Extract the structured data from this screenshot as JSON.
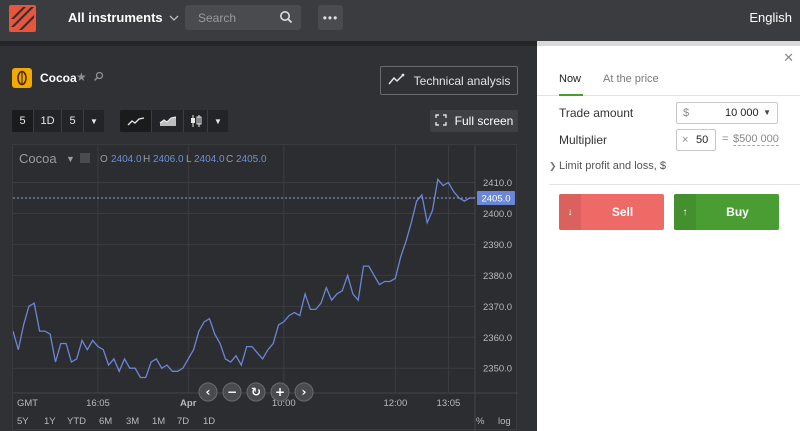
{
  "topbar": {
    "instruments_label": "All instruments",
    "search_placeholder": "Search",
    "more_label": "•••",
    "language": "English"
  },
  "asset": {
    "name": "Cocoa",
    "icon": "cocoa-bean-icon",
    "icon_color": "#f2a900"
  },
  "toolbar": {
    "technical_analysis": "Technical analysis",
    "full_screen": "Full screen",
    "interval_buttons": [
      "5",
      "1D",
      "5"
    ],
    "chart_type_icons": [
      "line-chart-icon",
      "area-chart-icon",
      "candlestick-icon"
    ]
  },
  "chart_header": {
    "asset": "Cocoa",
    "o_label": "O",
    "o_value": "2404.0",
    "h_label": "H",
    "h_value": "2406.0",
    "l_label": "L",
    "l_value": "2404.0",
    "c_label": "C",
    "c_value": "2405.0"
  },
  "chart_data": {
    "type": "line",
    "series": [
      {
        "values": [
          2362,
          2356,
          2364,
          2370,
          2371,
          2362,
          2362,
          2361,
          2352,
          2358,
          2358,
          2352,
          2353,
          2359,
          2356,
          2359,
          2357,
          2356,
          2351,
          2353,
          2349,
          2353,
          2350,
          2350,
          2347,
          2347,
          2352,
          2353,
          2350,
          2351,
          2349,
          2349,
          2350,
          2353,
          2356,
          2362,
          2365,
          2366,
          2361,
          2358,
          2353,
          2352,
          2354,
          2351,
          2357,
          2357,
          2355,
          2353,
          2356,
          2358,
          2364,
          2365,
          2367,
          2368,
          2367,
          2374,
          2369,
          2369,
          2371,
          2376,
          2372,
          2374,
          2375,
          2380,
          2374,
          2372,
          2383,
          2383,
          2380,
          2377,
          2378,
          2378,
          2379,
          2386,
          2391,
          2397,
          2404,
          2406,
          2397,
          2401,
          2411,
          2409,
          2410,
          2407,
          2405,
          2404,
          2405,
          2405
        ]
      }
    ],
    "current_price": "2405.0",
    "current_price_value": 2405,
    "ylim": [
      2342,
      2415
    ],
    "y_ticks": [
      "2410.0",
      "2400.0",
      "2390.0",
      "2380.0",
      "2370.0",
      "2360.0",
      "2350.0"
    ],
    "y_tick_values": [
      2410,
      2400,
      2390,
      2380,
      2370,
      2360,
      2350
    ],
    "x_labels": [
      "GMT",
      "16:05",
      "Apr",
      "10:00",
      "12:00",
      "13:05"
    ],
    "x_label_index": [
      0,
      16,
      33,
      51,
      72,
      82
    ],
    "grid": true
  },
  "nav_controls": [
    "chevron-left-icon",
    "zoom-out-icon",
    "reset-icon",
    "zoom-in-icon",
    "chevron-right-icon"
  ],
  "ranges": [
    "5Y",
    "1Y",
    "YTD",
    "6M",
    "3M",
    "1M",
    "7D",
    "1D"
  ],
  "scale_options": [
    "%",
    "log"
  ],
  "trade": {
    "tabs": [
      "Now",
      "At the price"
    ],
    "trade_amount_label": "Trade amount",
    "currency": "$",
    "amount": "10 000",
    "multiplier_label": "Multiplier",
    "multiplier_prefix": "×",
    "multiplier": "50",
    "equals": "=",
    "total": "$500 000",
    "limit_label": "Limit profit and loss, $",
    "sell": "Sell",
    "buy": "Buy",
    "sell_color": "#ee6a67",
    "buy_color": "#4a9d33"
  }
}
